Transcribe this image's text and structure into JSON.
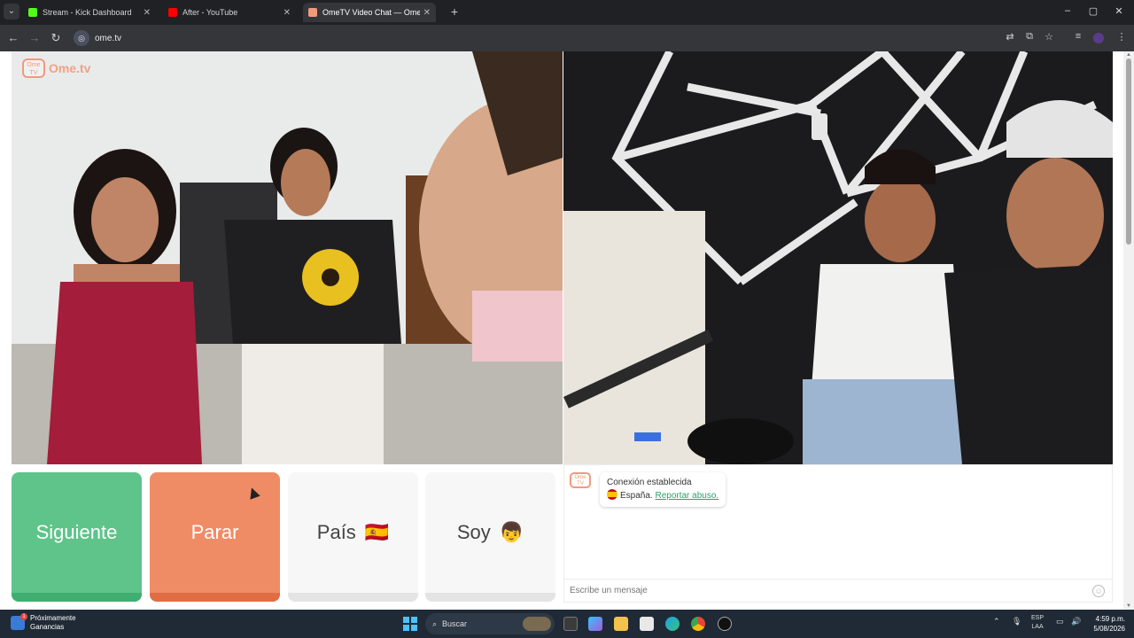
{
  "browser": {
    "tabs": [
      {
        "title": "Stream - Kick Dashboard",
        "favicon_color": "#53fc18"
      },
      {
        "title": "After - YouTube",
        "favicon_color": "#ff0000"
      },
      {
        "title": "OmeTV Video Chat — Ome",
        "favicon_color": "#f09a7c"
      }
    ],
    "url": "ome.tv"
  },
  "page": {
    "logo_text": "Ome.tv",
    "logo_badge": "Ome TV",
    "controls": {
      "next_label": "Siguiente",
      "stop_label": "Parar",
      "country_label": "País",
      "country_emoji": "🇪🇸",
      "gender_label": "Soy",
      "gender_emoji": "👦"
    },
    "chat": {
      "status": "Conexión establecida",
      "country": "España.",
      "report_link": "Reportar abuso.",
      "input_placeholder": "Escribe un mensaje"
    }
  },
  "taskbar": {
    "weather_line1": "Próximamente",
    "weather_line2": "Ganancias",
    "weather_badge": "1",
    "search_label": "Buscar",
    "lang_line1": "ESP",
    "lang_line2": "LAA",
    "time": "4:59 p.m.",
    "date": "5/08/2026"
  },
  "colors": {
    "next": "#5ec48a",
    "stop": "#ef8c66",
    "accent_link": "#26a56b"
  }
}
